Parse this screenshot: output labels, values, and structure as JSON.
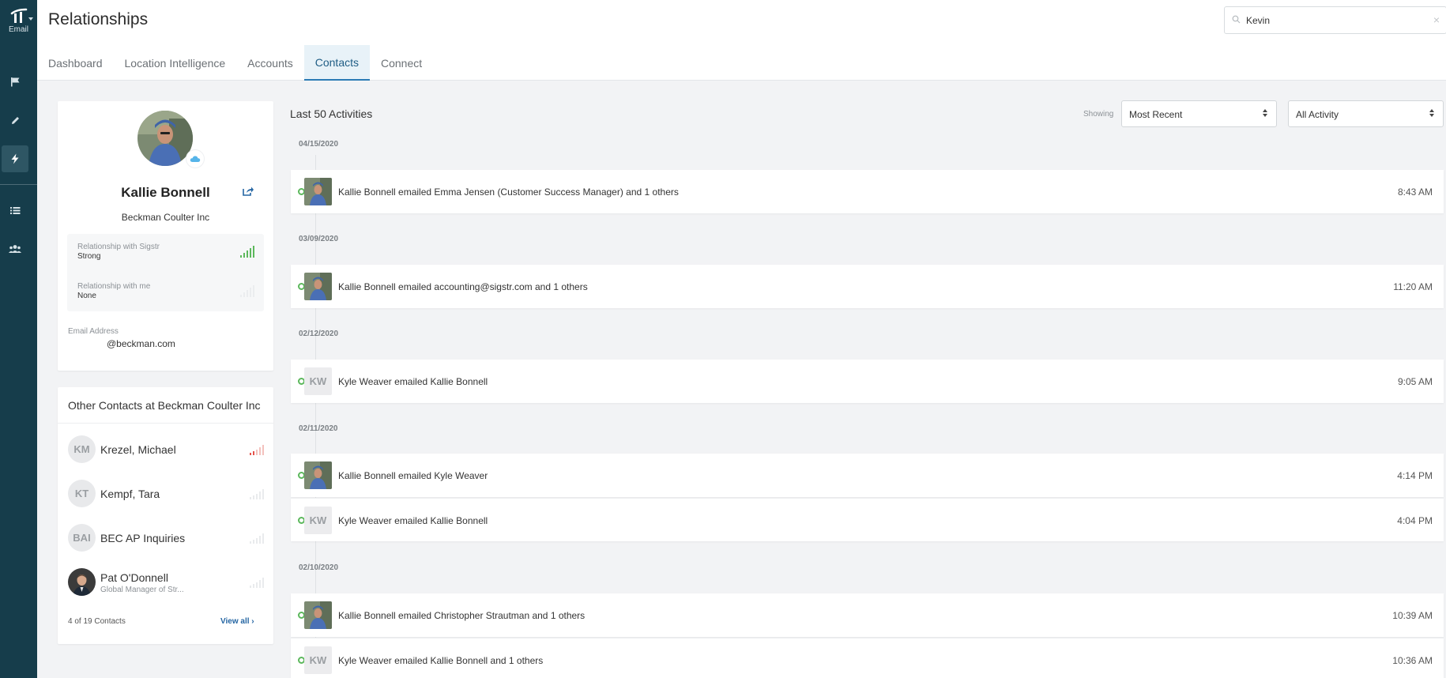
{
  "app": {
    "logo_label": "Email",
    "page_title": "Relationships"
  },
  "search": {
    "value": "Kevin",
    "clear": "×"
  },
  "tabs": [
    {
      "label": "Dashboard",
      "active": false
    },
    {
      "label": "Location Intelligence",
      "active": false
    },
    {
      "label": "Accounts",
      "active": false
    },
    {
      "label": "Contacts",
      "active": true
    },
    {
      "label": "Connect",
      "active": false
    }
  ],
  "rail_icons": [
    "flag-icon",
    "pencil-icon",
    "lightning-icon",
    "list-icon",
    "people-icon"
  ],
  "profile": {
    "name": "Kallie Bonnell",
    "company": "Beckman Coulter Inc",
    "relationship_sigstr_label": "Relationship with Sigstr",
    "relationship_sigstr_value": "Strong",
    "relationship_me_label": "Relationship with me",
    "relationship_me_value": "None",
    "email_label": "Email Address",
    "email_value": "@beckman.com"
  },
  "colors": {
    "rail": "#163d4b",
    "accent": "#2b7bb5",
    "strong": "#5cb85c",
    "weak": "#e5534b"
  },
  "other_contacts": {
    "title": "Other Contacts at Beckman Coulter Inc",
    "items": [
      {
        "initials": "KM",
        "name": "Krezel, Michael",
        "subtitle": ""
      },
      {
        "initials": "KT",
        "name": "Kempf, Tara",
        "subtitle": ""
      },
      {
        "initials": "BAI",
        "name": "BEC AP Inquiries",
        "subtitle": ""
      },
      {
        "initials": "",
        "name": "Pat O'Donnell",
        "subtitle": "Global Manager of Str..."
      }
    ],
    "count_text": "4 of 19 Contacts",
    "view_all": "View all ›"
  },
  "activities": {
    "title": "Last 50 Activities",
    "showing_label": "Showing",
    "sort_value": "Most Recent",
    "filter_value": "All Activity",
    "dates": [
      "04/15/2020",
      "03/09/2020",
      "02/12/2020",
      "02/11/2020",
      "02/10/2020"
    ],
    "items": [
      {
        "avatar": "photo",
        "text": "Kallie Bonnell emailed Emma Jensen (Customer Success Manager) and 1 others",
        "time": "8:43 AM"
      },
      {
        "avatar": "photo",
        "text": "Kallie Bonnell emailed accounting@sigstr.com and 1 others",
        "time": "11:20 AM"
      },
      {
        "avatar": "KW",
        "text": "Kyle Weaver emailed Kallie Bonnell",
        "time": "9:05 AM"
      },
      {
        "avatar": "photo",
        "text": "Kallie Bonnell emailed Kyle Weaver",
        "time": "4:14 PM"
      },
      {
        "avatar": "KW",
        "text": "Kyle Weaver emailed Kallie Bonnell",
        "time": "4:04 PM"
      },
      {
        "avatar": "photo",
        "text": "Kallie Bonnell emailed Christopher Strautman and 1 others",
        "time": "10:39 AM"
      },
      {
        "avatar": "KW",
        "text": "Kyle Weaver emailed Kallie Bonnell and 1 others",
        "time": "10:36 AM"
      }
    ]
  }
}
